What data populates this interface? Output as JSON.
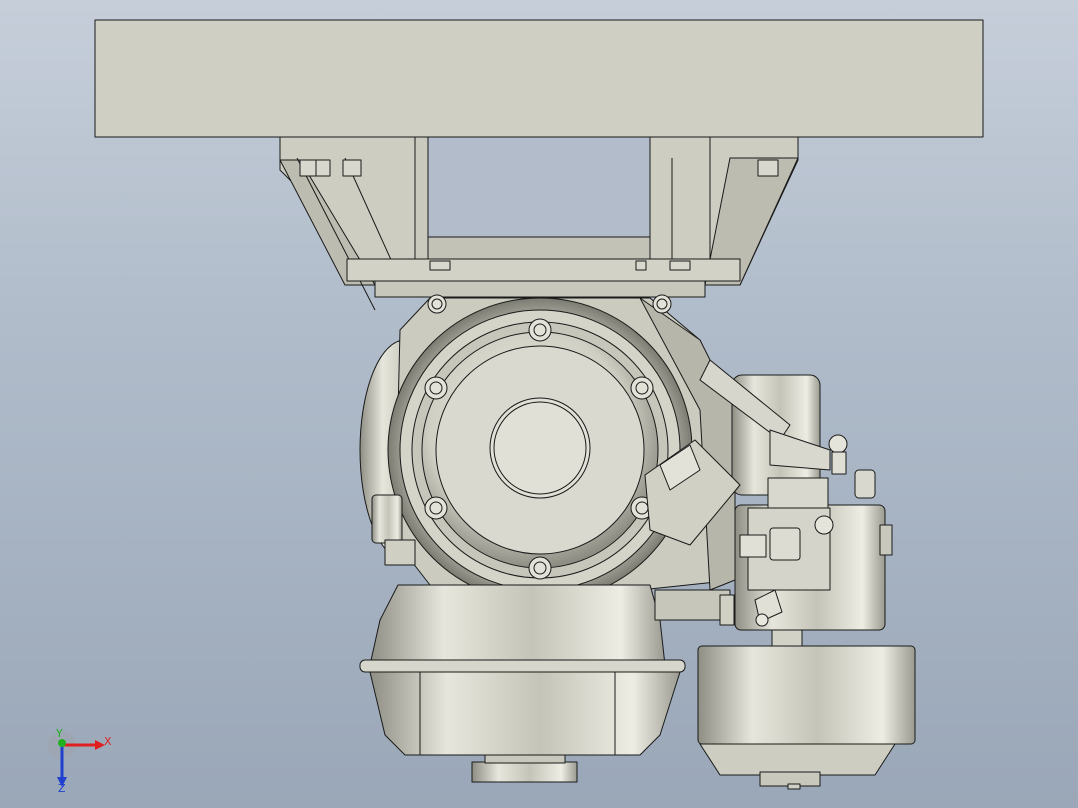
{
  "app": {
    "view": "CAD 3D viewport"
  },
  "triad": {
    "x_label": "X",
    "y_label": "Y",
    "z_label": "Z",
    "colors": {
      "x": "#e02020",
      "y": "#20b020",
      "z": "#2040d0"
    }
  },
  "model": {
    "part_fill": "#d2d2c6",
    "part_shade": "#a8a89c",
    "edge_color": "#1a1a1a"
  }
}
